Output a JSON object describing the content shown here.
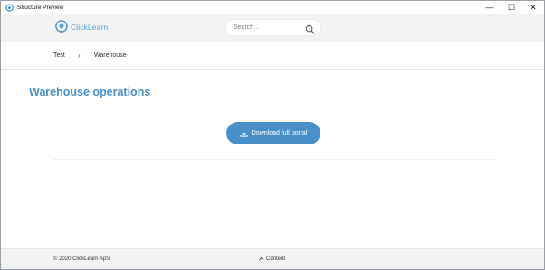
{
  "window": {
    "title": "Structure Preview",
    "controls": {
      "minimize": "—",
      "maximize": "☐",
      "close": "✕"
    }
  },
  "header": {
    "logo_text": "ClickLearn",
    "search": {
      "placeholder": "Search...",
      "value": ""
    }
  },
  "breadcrumb": {
    "items": [
      {
        "label": "Test"
      },
      {
        "label": "Warehouse"
      }
    ],
    "separator": "›"
  },
  "main": {
    "title": "Warehouse operations",
    "download_button": "Download full portal"
  },
  "footer": {
    "copyright": "© 2020 ClickLearn ApS",
    "content_link": "Content"
  },
  "colors": {
    "accent": "#4a90c8",
    "header_bg": "#f3f3f4"
  }
}
